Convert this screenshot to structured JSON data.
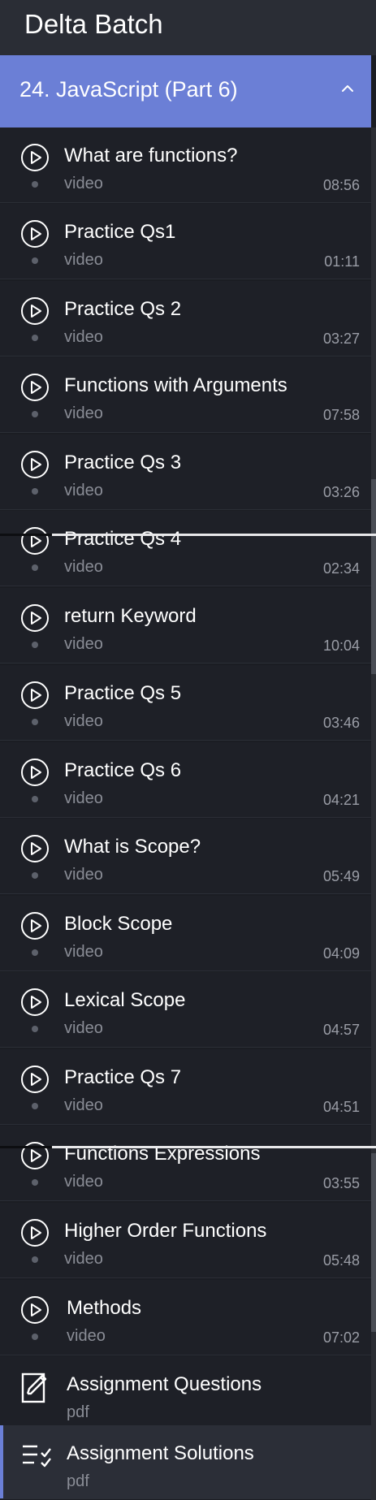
{
  "header": {
    "title": "Delta Batch"
  },
  "section": {
    "label": "24. JavaScript (Part 6)",
    "expanded_icon": "chevron-up-icon"
  },
  "lessons": [
    {
      "title": "What are functions?",
      "type": "video",
      "duration": "08:56",
      "icon": "play-circle-icon"
    },
    {
      "title": "Practice Qs1",
      "type": "video",
      "duration": "01:11",
      "icon": "play-circle-icon"
    },
    {
      "title": "Practice Qs 2",
      "type": "video",
      "duration": "03:27",
      "icon": "play-circle-icon"
    },
    {
      "title": "Functions with Arguments",
      "type": "video",
      "duration": "07:58",
      "icon": "play-circle-icon"
    },
    {
      "title": "Practice Qs 3",
      "type": "video",
      "duration": "03:26",
      "icon": "play-circle-icon"
    },
    {
      "title": "Practice Qs 4",
      "type": "video",
      "duration": "02:34",
      "icon": "play-circle-icon"
    },
    {
      "title": "return Keyword",
      "type": "video",
      "duration": "10:04",
      "icon": "play-circle-icon"
    },
    {
      "title": "Practice Qs 5",
      "type": "video",
      "duration": "03:46",
      "icon": "play-circle-icon"
    },
    {
      "title": "Practice Qs 6",
      "type": "video",
      "duration": "04:21",
      "icon": "play-circle-icon"
    },
    {
      "title": "What is Scope?",
      "type": "video",
      "duration": "05:49",
      "icon": "play-circle-icon"
    },
    {
      "title": "Block Scope",
      "type": "video",
      "duration": "04:09",
      "icon": "play-circle-icon"
    },
    {
      "title": "Lexical Scope",
      "type": "video",
      "duration": "04:57",
      "icon": "play-circle-icon"
    },
    {
      "title": "Practice Qs 7",
      "type": "video",
      "duration": "04:51",
      "icon": "play-circle-icon"
    },
    {
      "title": "Functions Expressions",
      "type": "video",
      "duration": "03:55",
      "icon": "play-circle-icon"
    },
    {
      "title": "Higher Order Functions",
      "type": "video",
      "duration": "05:48",
      "icon": "play-circle-icon"
    },
    {
      "title": "Methods",
      "type": "video",
      "duration": "07:02",
      "icon": "play-circle-icon"
    },
    {
      "title": "Assignment Questions",
      "type": "pdf",
      "icon": "edit-document-icon"
    },
    {
      "title": "Assignment Solutions",
      "type": "pdf",
      "icon": "checklist-icon"
    }
  ],
  "colors": {
    "accent": "#6b7fd6",
    "background": "#1b1d23",
    "row": "#1e2027"
  }
}
